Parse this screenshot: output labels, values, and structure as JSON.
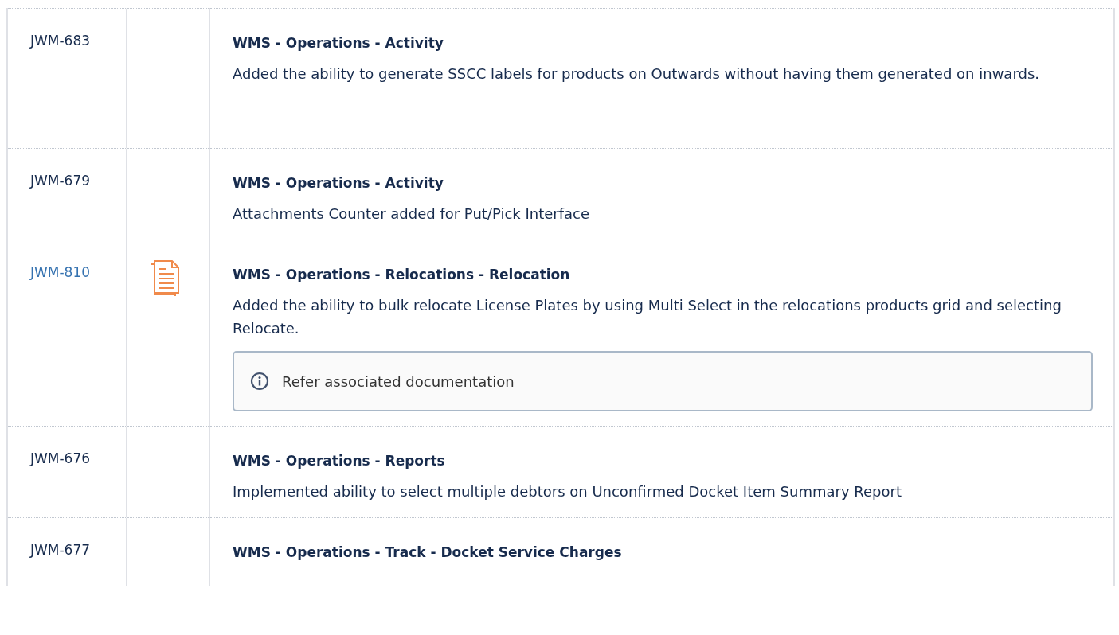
{
  "rows": [
    {
      "id": "JWM-683",
      "id_is_link": false,
      "has_document": false,
      "heading": "WMS - Operations - Activity",
      "description": "Added the ability to generate SSCC labels for products on Outwards without having them generated on inwards."
    },
    {
      "id": "JWM-679",
      "id_is_link": false,
      "has_document": false,
      "heading": "WMS - Operations - Activity",
      "description": "Attachments Counter added for Put/Pick Interface"
    },
    {
      "id": "JWM-810",
      "id_is_link": true,
      "has_document": true,
      "heading": "WMS - Operations - Relocations - Relocation",
      "description": "Added the ability to bulk relocate License Plates by using Multi Select in the relocations products grid and selecting Relocate.",
      "note": "Refer associated documentation"
    },
    {
      "id": "JWM-676",
      "id_is_link": false,
      "has_document": false,
      "heading": "WMS - Operations - Reports",
      "description": "Implemented ability to select multiple debtors on Unconfirmed Docket Item Summary Report"
    },
    {
      "id": "JWM-677",
      "id_is_link": false,
      "has_document": false,
      "heading": "WMS - Operations - Track - Docket Service Charges"
    }
  ]
}
